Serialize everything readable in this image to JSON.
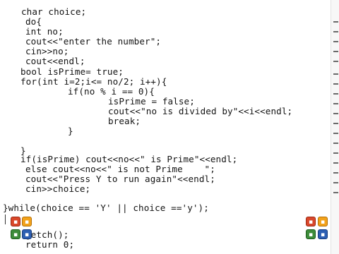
{
  "editor": {
    "lines": [
      {
        "text": "char choice;"
      },
      {
        "text": "do{"
      },
      {
        "text": "int no;"
      },
      {
        "text": "cout<<\"enter the number\";"
      },
      {
        "text": "cin>>no;"
      },
      {
        "text": "cout<<endl;"
      },
      {
        "text": "bool isPrime= true;"
      },
      {
        "text": "for(int i=2;i<= no/2; i++){"
      },
      {
        "text": "if(no % i == 0){"
      },
      {
        "text": "isPrime = false;"
      },
      {
        "text": "cout<<\"no is divided by\"<<i<<endl;"
      },
      {
        "text": "break;"
      },
      {
        "text": "}"
      },
      {
        "text": ""
      },
      {
        "text": "}"
      },
      {
        "text": "if(isPrime) cout<<no<<\" is Prime\"<<endl;"
      },
      {
        "text": "else cout<<no<<\" is not Prime    \";"
      },
      {
        "text": "cout<<\"Press Y to run again\"<<endl;"
      },
      {
        "text": "cin>>choice;"
      },
      {
        "text": ""
      },
      {
        "text": "}while(choice == 'Y' || choice =='y');"
      },
      {
        "text": ""
      },
      {
        "text": "getch();"
      },
      {
        "text": "return 0;"
      }
    ]
  },
  "toolbar": {
    "left_top": [
      "red-action-icon",
      "orange-action-icon"
    ],
    "left_bottom": [
      "green-action-icon",
      "blue-action-icon"
    ],
    "right_top": [
      "red-action-icon",
      "orange-action-icon"
    ],
    "right_bottom": [
      "green-action-icon",
      "blue-action-icon"
    ]
  },
  "colors": {
    "background": "#ffffff",
    "text": "#141414",
    "keyword": "#1f3fa0"
  }
}
